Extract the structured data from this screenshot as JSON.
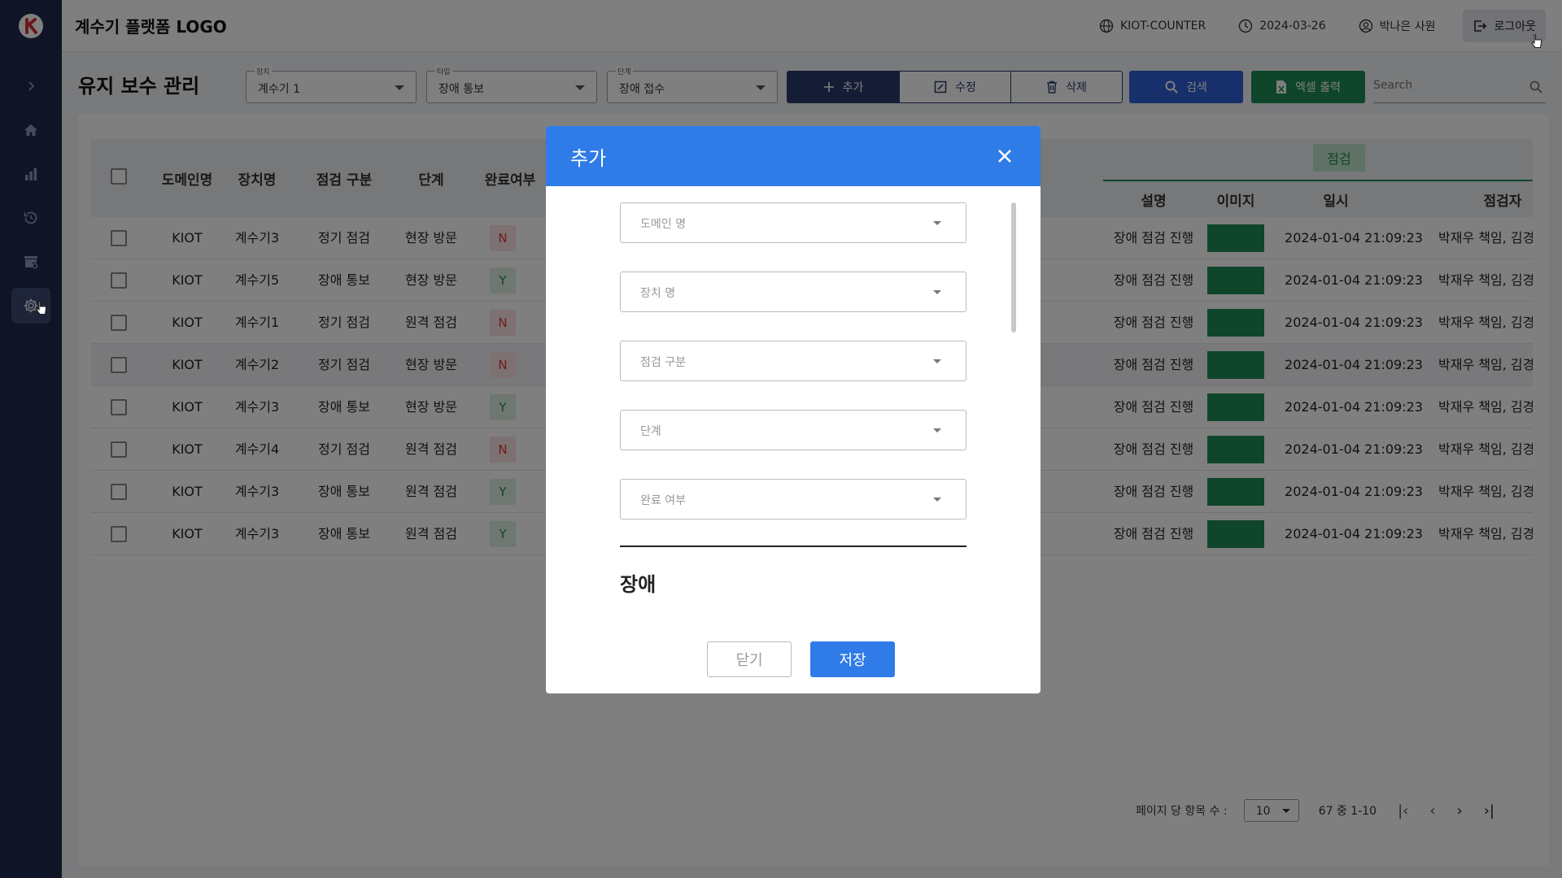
{
  "header": {
    "app_title": "계수기 플랫폼 LOGO",
    "site": "KIOT-COUNTER",
    "date": "2024-03-26",
    "user": "박나은 사원",
    "logout_label": "로그아웃"
  },
  "sidebar": {
    "items": [
      {
        "icon": "chevron-right-icon"
      },
      {
        "icon": "home-icon"
      },
      {
        "icon": "bar-chart-icon"
      },
      {
        "icon": "history-icon"
      },
      {
        "icon": "store-settings-icon"
      },
      {
        "icon": "gear-icon",
        "active": true
      }
    ]
  },
  "page": {
    "title": "유지 보수 관리",
    "filters": [
      {
        "label": "장치",
        "value": "계수기 1"
      },
      {
        "label": "타입",
        "value": "장애 통보"
      },
      {
        "label": "단계",
        "value": "장애 접수"
      }
    ],
    "actions": {
      "add": "추가",
      "edit": "수정",
      "delete": "삭제"
    },
    "search_button": "검색",
    "excel_button": "엑셀 출력",
    "search_placeholder": "Search"
  },
  "table": {
    "columns": [
      "도메인명",
      "장치명",
      "점검 구분",
      "단계",
      "완료여부",
      "설명",
      "이미지",
      "일시",
      "점검자"
    ],
    "group_label": "점검",
    "rows": [
      {
        "domain": "KIOT",
        "device": "계수기3",
        "type": "정기 점검",
        "stage": "현장 방문",
        "done": "N",
        "desc": "장애 점검 진행",
        "datetime": "2024-01-04 21:09:23",
        "inspector": "박재우 책임, 김경"
      },
      {
        "domain": "KIOT",
        "device": "계수기5",
        "type": "장애 통보",
        "stage": "현장 방문",
        "done": "Y",
        "desc": "장애 점검 진행",
        "datetime": "2024-01-04 21:09:23",
        "inspector": "박재우 책임, 김경"
      },
      {
        "domain": "KIOT",
        "device": "계수기1",
        "type": "정기 점검",
        "stage": "원격 점검",
        "done": "N",
        "desc": "장애 점검 진행",
        "datetime": "2024-01-04 21:09:23",
        "inspector": "박재우 책임, 김경"
      },
      {
        "domain": "KIOT",
        "device": "계수기2",
        "type": "정기 점검",
        "stage": "현장 방문",
        "done": "N",
        "desc": "장애 점검 진행",
        "datetime": "2024-01-04 21:09:23",
        "inspector": "박재우 책임, 김경"
      },
      {
        "domain": "KIOT",
        "device": "계수기3",
        "type": "장애 통보",
        "stage": "현장 방문",
        "done": "Y",
        "desc": "장애 점검 진행",
        "datetime": "2024-01-04 21:09:23",
        "inspector": "박재우 책임, 김경"
      },
      {
        "domain": "KIOT",
        "device": "계수기4",
        "type": "정기 점검",
        "stage": "원격 점검",
        "done": "N",
        "desc": "장애 점검 진행",
        "datetime": "2024-01-04 21:09:23",
        "inspector": "박재우 책임, 김경"
      },
      {
        "domain": "KIOT",
        "device": "계수기3",
        "type": "장애 통보",
        "stage": "원격 점검",
        "done": "Y",
        "desc": "장애 점검 진행",
        "datetime": "2024-01-04 21:09:23",
        "inspector": "박재우 책임, 김경"
      },
      {
        "domain": "KIOT",
        "device": "계수기3",
        "type": "장애 통보",
        "stage": "원격 점검",
        "done": "Y",
        "desc": "장애 점검 진행",
        "datetime": "2024-01-04 21:09:23",
        "inspector": "박재우 책임, 김경"
      }
    ]
  },
  "pagination": {
    "per_page_label": "페이지 당 항목 수 :",
    "per_page": "10",
    "range": "67 중 1-10"
  },
  "modal": {
    "title": "추가",
    "fields": [
      {
        "placeholder": "도메인 명"
      },
      {
        "placeholder": "장치 명"
      },
      {
        "placeholder": "점검 구분"
      },
      {
        "placeholder": "단계"
      },
      {
        "placeholder": "완료 여부"
      }
    ],
    "section_title": "장애",
    "close_label": "닫기",
    "save_label": "저장"
  },
  "colors": {
    "sidebar": "#1f2a4d",
    "primary": "#2f7be8",
    "excel": "#1f8a55",
    "navy": "#2a3a6c"
  }
}
